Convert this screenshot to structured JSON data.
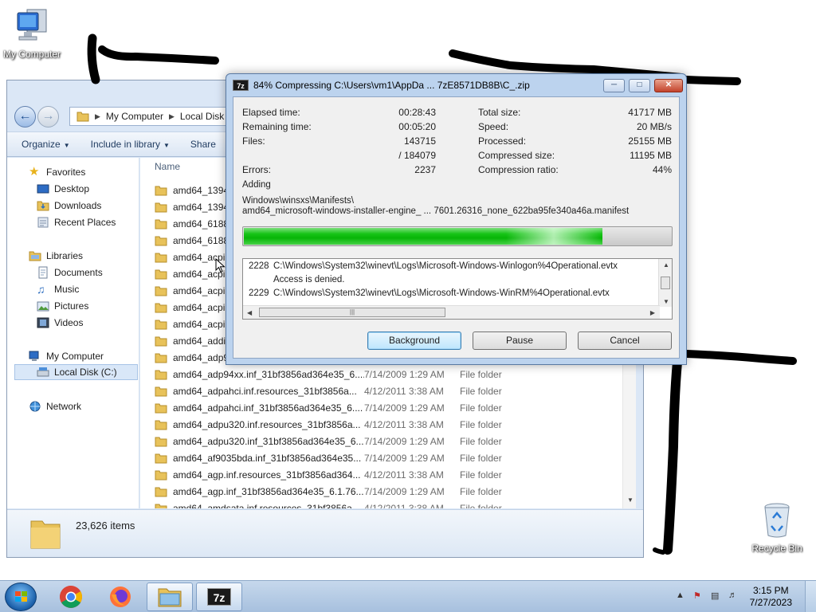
{
  "desktop": {
    "icons": [
      {
        "label": "My Computer",
        "icon": "computer-icon"
      },
      {
        "label": "Recycle Bin",
        "icon": "recycle-bin-icon"
      }
    ]
  },
  "explorer": {
    "breadcrumb": [
      "My Computer",
      "Local Disk ("
    ],
    "toolbar": {
      "organize": "Organize",
      "include": "Include in library",
      "share": "Share"
    },
    "nav": {
      "favorites": "Favorites",
      "desktop": "Desktop",
      "downloads": "Downloads",
      "recent": "Recent Places",
      "libraries": "Libraries",
      "documents": "Documents",
      "music": "Music",
      "pictures": "Pictures",
      "videos": "Videos",
      "computer": "My Computer",
      "local_disk": "Local Disk (C:)",
      "network": "Network"
    },
    "column_name": "Name",
    "rows": [
      {
        "name": "amd64_1394.",
        "date": "",
        "type": ""
      },
      {
        "name": "amd64_1394.",
        "date": "",
        "type": ""
      },
      {
        "name": "amd64_61883",
        "date": "",
        "type": ""
      },
      {
        "name": "amd64_61883",
        "date": "",
        "type": ""
      },
      {
        "name": "amd64_acpi.i",
        "date": "",
        "type": ""
      },
      {
        "name": "amd64_acpi.",
        "date": "",
        "type": ""
      },
      {
        "name": "amd64_acpi.i",
        "date": "",
        "type": ""
      },
      {
        "name": "amd64_acpip",
        "date": "",
        "type": ""
      },
      {
        "name": "amd64_acpip",
        "date": "",
        "type": ""
      },
      {
        "name": "amd64_addin",
        "date": "",
        "type": ""
      },
      {
        "name": "amd64_adp94",
        "date": "",
        "type": ""
      },
      {
        "name": "amd64_adp94xx.inf_31bf3856ad364e35_6....",
        "date": "7/14/2009 1:29 AM",
        "type": "File folder"
      },
      {
        "name": "amd64_adpahci.inf.resources_31bf3856a...",
        "date": "4/12/2011 3:38 AM",
        "type": "File folder"
      },
      {
        "name": "amd64_adpahci.inf_31bf3856ad364e35_6....",
        "date": "7/14/2009 1:29 AM",
        "type": "File folder"
      },
      {
        "name": "amd64_adpu320.inf.resources_31bf3856a...",
        "date": "4/12/2011 3:38 AM",
        "type": "File folder"
      },
      {
        "name": "amd64_adpu320.inf_31bf3856ad364e35_6....",
        "date": "7/14/2009 1:29 AM",
        "type": "File folder"
      },
      {
        "name": "amd64_af9035bda.inf_31bf3856ad364e35...",
        "date": "7/14/2009 1:29 AM",
        "type": "File folder"
      },
      {
        "name": "amd64_agp.inf.resources_31bf3856ad364...",
        "date": "4/12/2011 3:38 AM",
        "type": "File folder"
      },
      {
        "name": "amd64_agp.inf_31bf3856ad364e35_6.1.76...",
        "date": "7/14/2009 1:29 AM",
        "type": "File folder"
      },
      {
        "name": "amd64_amdsata.inf.resources_31bf3856a...",
        "date": "4/12/2011 3:38 AM",
        "type": "File folder"
      }
    ],
    "item_count": "23,626 items"
  },
  "dialog": {
    "title": "84% Compressing C:\\Users\\vm1\\AppDa ... 7zE8571DB8B\\C_.zip",
    "app_icon_text": "7z",
    "stats_left": [
      {
        "label": "Elapsed time:",
        "value": "00:28:43"
      },
      {
        "label": "Remaining time:",
        "value": "00:05:20"
      },
      {
        "label": "Files:",
        "value": "143715"
      },
      {
        "label": "",
        "value": "/ 184079"
      },
      {
        "label": "Errors:",
        "value": "2237"
      }
    ],
    "stats_right": [
      {
        "label": "Total size:",
        "value": "41717 MB"
      },
      {
        "label": "Speed:",
        "value": "20 MB/s"
      },
      {
        "label": "Processed:",
        "value": "25155 MB"
      },
      {
        "label": "Compressed size:",
        "value": "11195 MB"
      },
      {
        "label": "Compression ratio:",
        "value": "44%"
      }
    ],
    "adding_label": "Adding",
    "current_path": "Windows\\winsxs\\Manifests\\",
    "current_file": "amd64_microsoft-windows-installer-engine_ ... 7601.26316_none_622ba95fe340a46a.manifest",
    "progress_fraction": 0.84,
    "log": [
      {
        "num": "2228",
        "text": "C:\\Windows\\System32\\winevt\\Logs\\Microsoft-Windows-Winlogon%4Operational.evtx"
      },
      {
        "num": "",
        "text": "Access is denied."
      },
      {
        "num": "2229",
        "text": "C:\\Windows\\System32\\winevt\\Logs\\Microsoft-Windows-WinRM%4Operational.evtx"
      }
    ],
    "buttons": {
      "background": "Background",
      "pause": "Pause",
      "cancel": "Cancel"
    }
  },
  "taskbar": {
    "time": "3:15 PM",
    "date": "7/27/2023"
  }
}
